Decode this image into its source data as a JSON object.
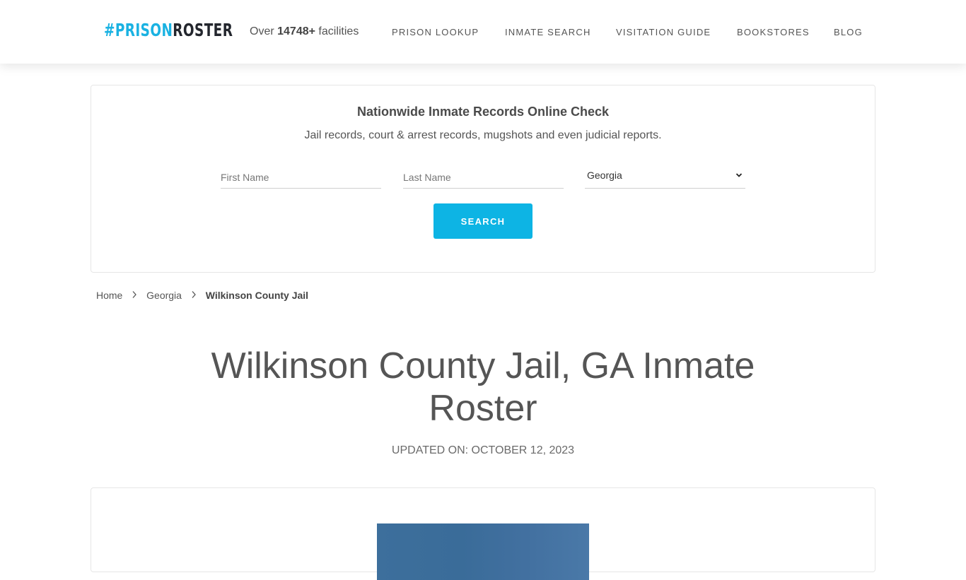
{
  "header": {
    "logo_part_a": "#PRISON",
    "logo_part_b": "ROSTER",
    "facilities_prefix": "Over ",
    "facilities_count": "14748+",
    "facilities_suffix": " facilities",
    "nav": [
      {
        "label": "PRISON LOOKUP"
      },
      {
        "label": "INMATE SEARCH"
      },
      {
        "label": "VISITATION GUIDE"
      },
      {
        "label": "BOOKSTORES"
      },
      {
        "label": "BLOG"
      }
    ]
  },
  "search": {
    "title": "Nationwide Inmate Records Online Check",
    "subtitle": "Jail records, court & arrest records, mugshots and even judicial reports.",
    "first_name_placeholder": "First Name",
    "first_name_value": "",
    "last_name_placeholder": "Last Name",
    "last_name_value": "",
    "state_selected": "Georgia",
    "button_label": "SEARCH"
  },
  "breadcrumb": {
    "items": [
      {
        "label": "Home"
      },
      {
        "label": "Georgia"
      }
    ],
    "current": "Wilkinson County Jail"
  },
  "page": {
    "title": "Wilkinson County Jail, GA Inmate Roster",
    "updated": "UPDATED ON: OCTOBER 12, 2023"
  },
  "colors": {
    "brand_blue": "#1ab2e2",
    "brand_dark": "#23262d",
    "button_blue": "#0db4e4",
    "text_gray": "#555555"
  }
}
